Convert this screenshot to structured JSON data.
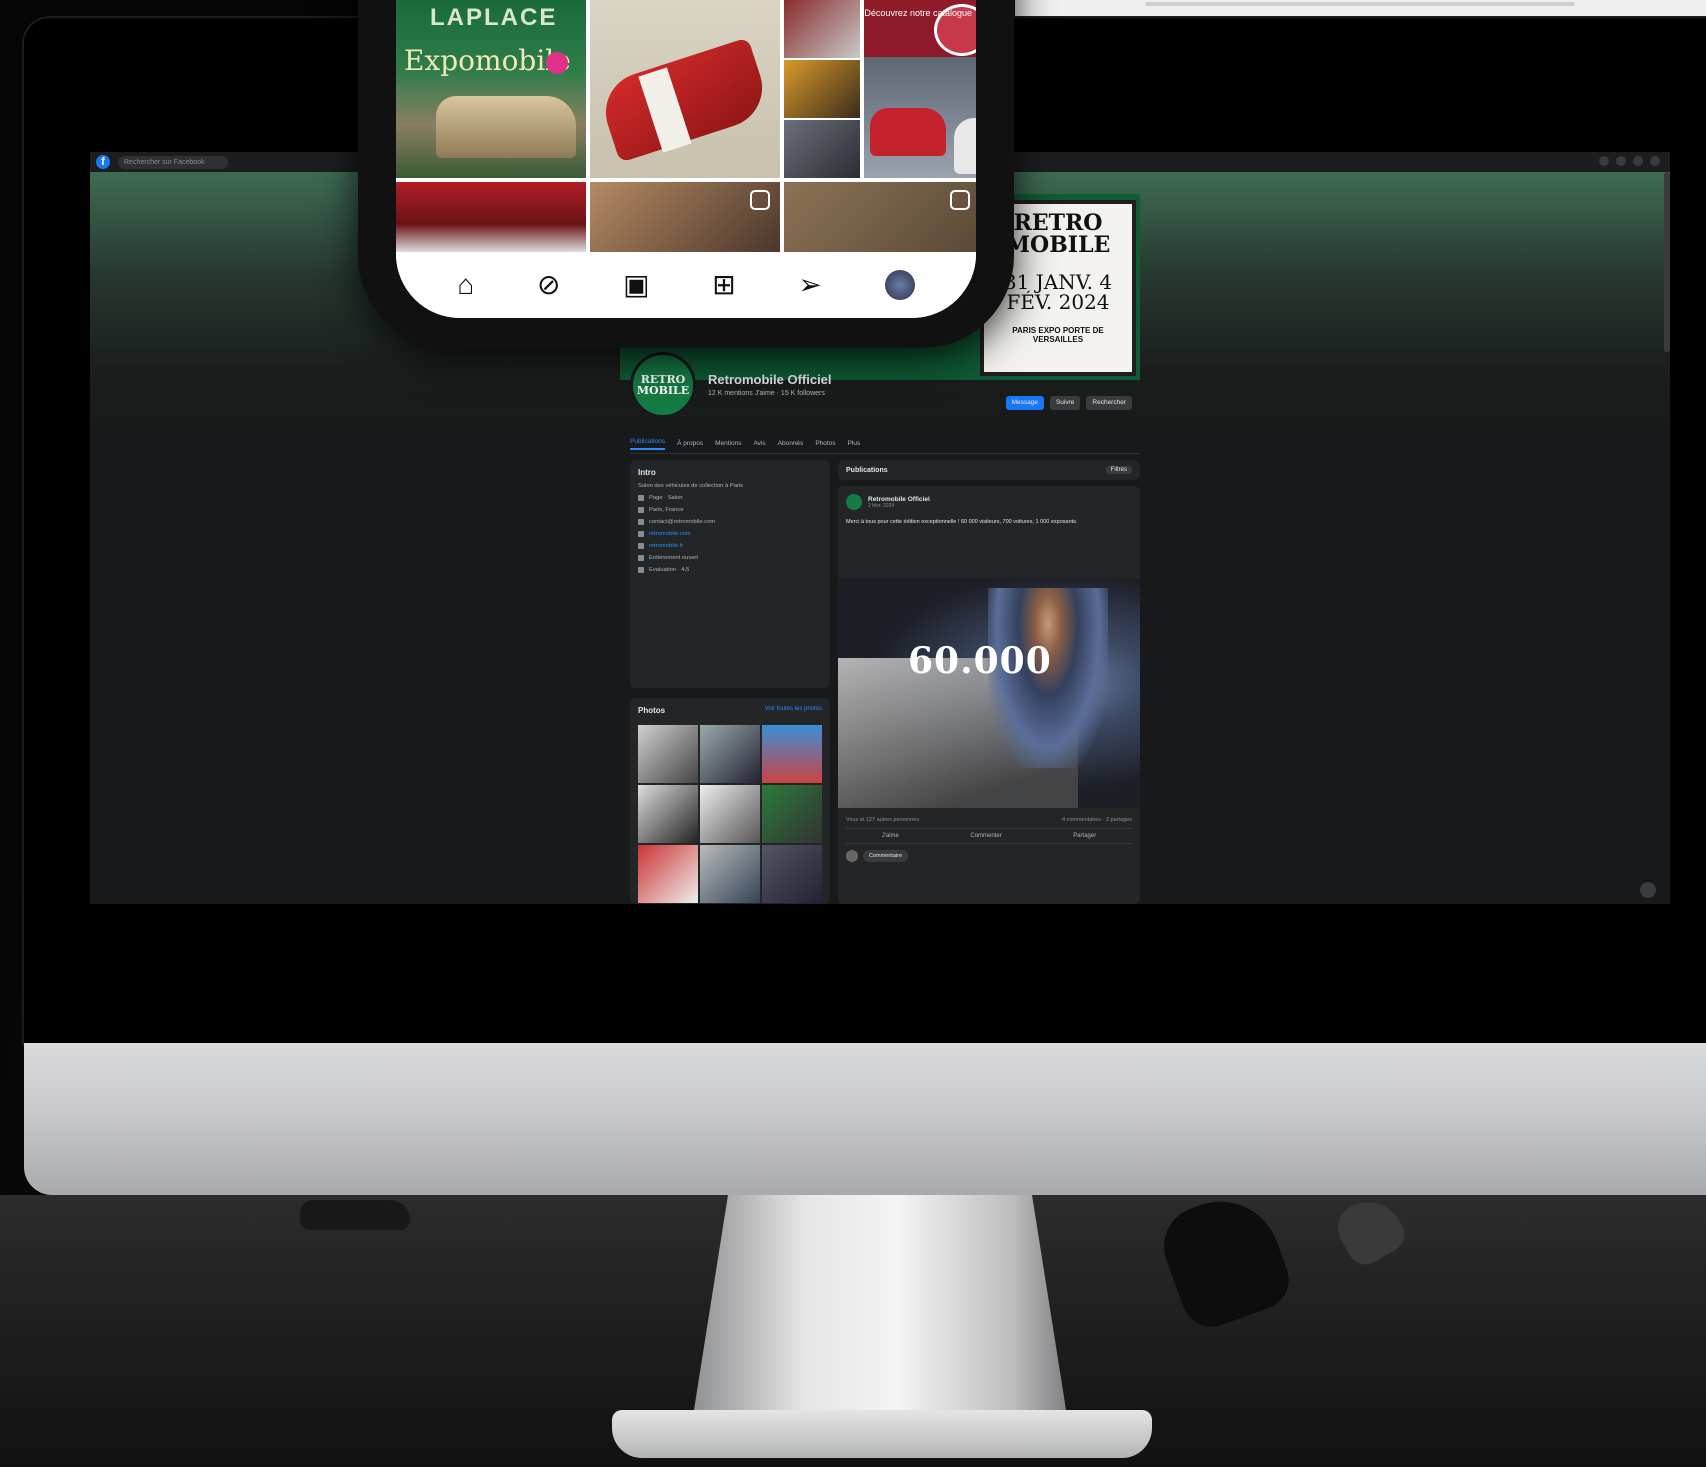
{
  "facebook": {
    "search_placeholder": "Rechercher sur Facebook",
    "cover": {
      "poster_line1": "RETRO MOBILE",
      "poster_dates": "31 JANV. 4 FÉV. 2024",
      "poster_venue": "PARIS EXPO PORTE DE VERSAILLES"
    },
    "profile": {
      "avatar_text": "RETRO MOBILE",
      "name": "Retromobile Officiel",
      "meta": "12 K mentions J'aime · 15 K followers",
      "buttons": {
        "message": "Message",
        "follow": "Suivre",
        "search": "Rechercher"
      }
    },
    "tabs": [
      "Publications",
      "À propos",
      "Mentions",
      "Avis",
      "Abonnés",
      "Photos",
      "Plus"
    ],
    "intro": {
      "title": "Intro",
      "lines": [
        "Salon des véhicules de collection à Paris",
        "Page · Salon",
        "Paris, France",
        "contact@retromobile.com",
        "retromobile.com",
        "retromobile.fr",
        "Entièrement ouvert",
        "Évaluation · 4,5"
      ]
    },
    "photos": {
      "title": "Photos",
      "see_all": "Voir toutes les photos"
    },
    "posts": {
      "title": "Publications",
      "filter": "Filtres",
      "post": {
        "name": "Retromobile Officiel",
        "time": "2 févr. 2024",
        "text": "Merci à tous pour cette édition exceptionnelle ! 60 000 visiteurs, 700 voitures, 1 000 exposants.",
        "big_number": "60.000",
        "reactions": "Vous et 127 autres personnes",
        "comments": "4 commentaires · 2 partages",
        "actions": [
          "J'aime",
          "Commenter",
          "Partager"
        ],
        "comment": "Commentaire"
      }
    }
  },
  "instagram": {
    "tile1_title": "LAPLACE",
    "tile1_sub": "Expomobile",
    "tile4_text": "Découvrez notre catalogue",
    "nav": [
      "home-icon",
      "explore-icon",
      "reels-icon",
      "new-post-icon",
      "direct-icon",
      "profile-avatar"
    ]
  },
  "colors": {
    "facebook_blue": "#1877f2",
    "retromobile_green": "#167a44",
    "dark_bg": "#18191a"
  }
}
